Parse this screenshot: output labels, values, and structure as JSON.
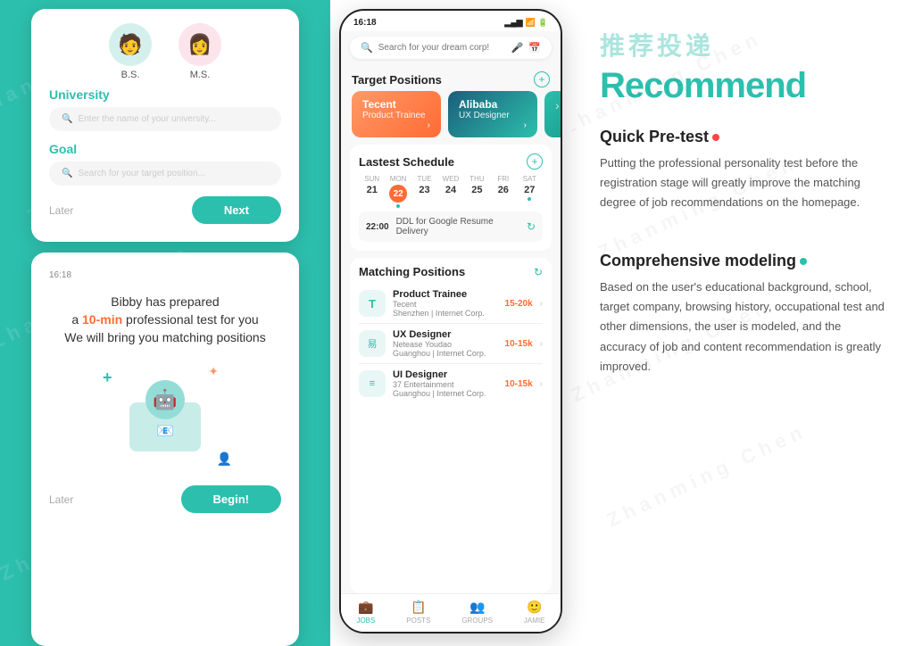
{
  "leftPanel": {
    "topCard": {
      "avatars": [
        {
          "label": "B.S.",
          "emoji": "🧑",
          "gender": "male"
        },
        {
          "label": "M.S.",
          "emoji": "👩",
          "gender": "female"
        }
      ],
      "universityLabel": "University",
      "universityPlaceholder": "Enter the name of your university...",
      "goalLabel": "Goal",
      "goalPlaceholder": "Search for your target position...",
      "laterBtn": "Later",
      "nextBtn": "Next"
    },
    "bottomCard": {
      "timeBadge": "16:18",
      "line1": "Bibby has prepared",
      "highlight": "10-min",
      "line2text": " professional test for you",
      "line3": "We will bring you matching positions",
      "laterBtn": "Later",
      "beginBtn": "Begin!"
    }
  },
  "middlePhone": {
    "time": "16:18",
    "searchPlaceholder": "Search for your dream corp!",
    "targetPositions": {
      "title": "Target Positions",
      "positions": [
        {
          "company": "Tecent",
          "role": "Product Trainee",
          "style": "tencent"
        },
        {
          "company": "Alibaba",
          "role": "UX Designer",
          "style": "alibaba"
        }
      ]
    },
    "lastestSchedule": {
      "title": "Lastest Schedule",
      "days": [
        {
          "dow": "SUN",
          "date": "21"
        },
        {
          "dow": "MON",
          "date": "22",
          "today": true,
          "dot": true
        },
        {
          "dow": "TUE",
          "date": "23"
        },
        {
          "dow": "WED",
          "date": "24"
        },
        {
          "dow": "THU",
          "date": "25"
        },
        {
          "dow": "FRI",
          "date": "26"
        },
        {
          "dow": "SAT",
          "date": "27",
          "dot": true
        }
      ],
      "ddl": {
        "time": "22:00",
        "text": "DDL for Google Resume Delivery"
      }
    },
    "matchingPositions": {
      "title": "Matching Positions",
      "jobs": [
        {
          "icon": "T",
          "iconStyle": "product",
          "title": "Product Trainee",
          "company": "Tecent",
          "salary": "15-20k",
          "location": "Shenzhen | Internet Corp."
        },
        {
          "icon": "易",
          "iconStyle": "ux",
          "title": "UX Designer",
          "company": "Netease Youdao",
          "salary": "10-15k",
          "location": "Guanghou | Internet Corp."
        },
        {
          "icon": "≡",
          "iconStyle": "ui",
          "title": "UI Designer",
          "company": "37 Entertainment",
          "salary": "10-15k",
          "location": "Guanghou | Internet Corp."
        }
      ]
    },
    "bottomNav": [
      {
        "label": "JOBS",
        "icon": "💼",
        "active": true
      },
      {
        "label": "POSTS",
        "icon": "📋",
        "active": false
      },
      {
        "label": "GROUPS",
        "icon": "👥",
        "active": false
      },
      {
        "label": "JAMIE",
        "icon": "🙂",
        "active": false
      }
    ]
  },
  "rightPanel": {
    "chineseTitle": "推荐投递",
    "mainTitle": "Recommend",
    "features": [
      {
        "title": "Quick Pre-test",
        "dotColor": "red",
        "description": "Putting the professional personality test before the registration stage will greatly improve the matching degree of job recommendations on the homepage."
      },
      {
        "title": "Comprehensive modeling",
        "dotColor": "teal",
        "description": "Based on the user's educational background, school, target company, browsing history, occupational test and other dimensions, the user is modeled, and the accuracy of job and content recommendation is greatly improved."
      }
    ]
  },
  "watermark": {
    "text1": "Zhanming Chen",
    "text2": "Zhanming Chen"
  }
}
